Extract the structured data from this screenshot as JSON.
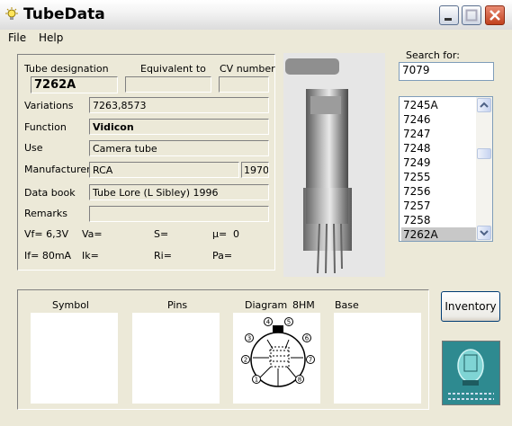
{
  "window": {
    "title": "TubeData"
  },
  "menu": {
    "file": "File",
    "help": "Help"
  },
  "details": {
    "tube_designation_label": "Tube designation",
    "equivalent_label": "Equivalent to",
    "cv_label": "CV number",
    "tube_designation": "7262A",
    "equivalent": "",
    "cv_number": "",
    "variations_label": "Variations",
    "variations": "7263,8573",
    "function_label": "Function",
    "function": "Vidicon",
    "use_label": "Use",
    "use": "Camera tube",
    "manufacturer_label": "Manufacturer",
    "manufacturer": "RCA",
    "year": "1970",
    "databook_label": "Data book",
    "databook": "Tube Lore (L Sibley) 1996",
    "remarks_label": "Remarks",
    "remarks": "",
    "params": {
      "vf": "Vf= 6,3V",
      "va": "Va=",
      "s": "S=",
      "mu": "µ=",
      "mu_value": "0",
      "if": "If= 80mA",
      "ik": "Ik=",
      "ri": "Ri=",
      "pa": "Pa="
    }
  },
  "search": {
    "label": "Search for:",
    "value": "7079",
    "items": [
      "7245A",
      "7246",
      "7247",
      "7248",
      "7249",
      "7255",
      "7256",
      "7257",
      "7258",
      "7262A"
    ],
    "selected": "7262A"
  },
  "bottom": {
    "symbol_label": "Symbol",
    "pins_label": "Pins",
    "diagram_label": "Diagram",
    "diagram_code": "8HM",
    "base_label": "Base",
    "pin_numbers": [
      "1",
      "2",
      "3",
      "4",
      "5",
      "6",
      "7",
      "8"
    ]
  },
  "inventory_button": "Inventory",
  "colors": {
    "close": "#c1411f",
    "selection": "#c8c8c8",
    "logo_bg": "#2a7f86"
  }
}
